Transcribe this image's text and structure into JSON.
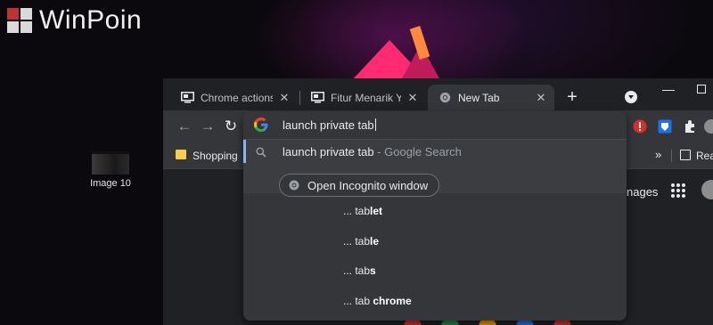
{
  "watermark": {
    "brand": "WinPoin"
  },
  "desktop": {
    "icon_label": "Image 10"
  },
  "tabs": [
    {
      "title": "Chrome actions | W"
    },
    {
      "title": "Fitur Menarik Yang"
    },
    {
      "title": "New Tab"
    }
  ],
  "omnibox": {
    "query": "launch private tab"
  },
  "bookmarks": {
    "folder": "Shopping",
    "more": "»",
    "reading": "Rea"
  },
  "ntp": {
    "images_link": "nages"
  },
  "suggestions": {
    "main": {
      "text": "launch private tab",
      "source": " - Google Search"
    },
    "action_button": "Open Incognito window",
    "items": [
      {
        "prefix": "... tab",
        "bold": "let"
      },
      {
        "prefix": "... tab",
        "bold": "le"
      },
      {
        "prefix": "... tab",
        "bold": "s"
      },
      {
        "prefix": "... tab ",
        "bold": "chrome"
      }
    ]
  },
  "colors": {
    "accent": "#8ab4f8",
    "panel": "#35363a",
    "frame": "#202124",
    "ext_red": "#d93025",
    "ext_blue": "#1a73e8"
  },
  "icons": [
    "back-icon",
    "forward-icon",
    "reload-icon",
    "google-icon",
    "search-icon",
    "incognito-icon",
    "puzzle-icon",
    "apps-icon"
  ]
}
